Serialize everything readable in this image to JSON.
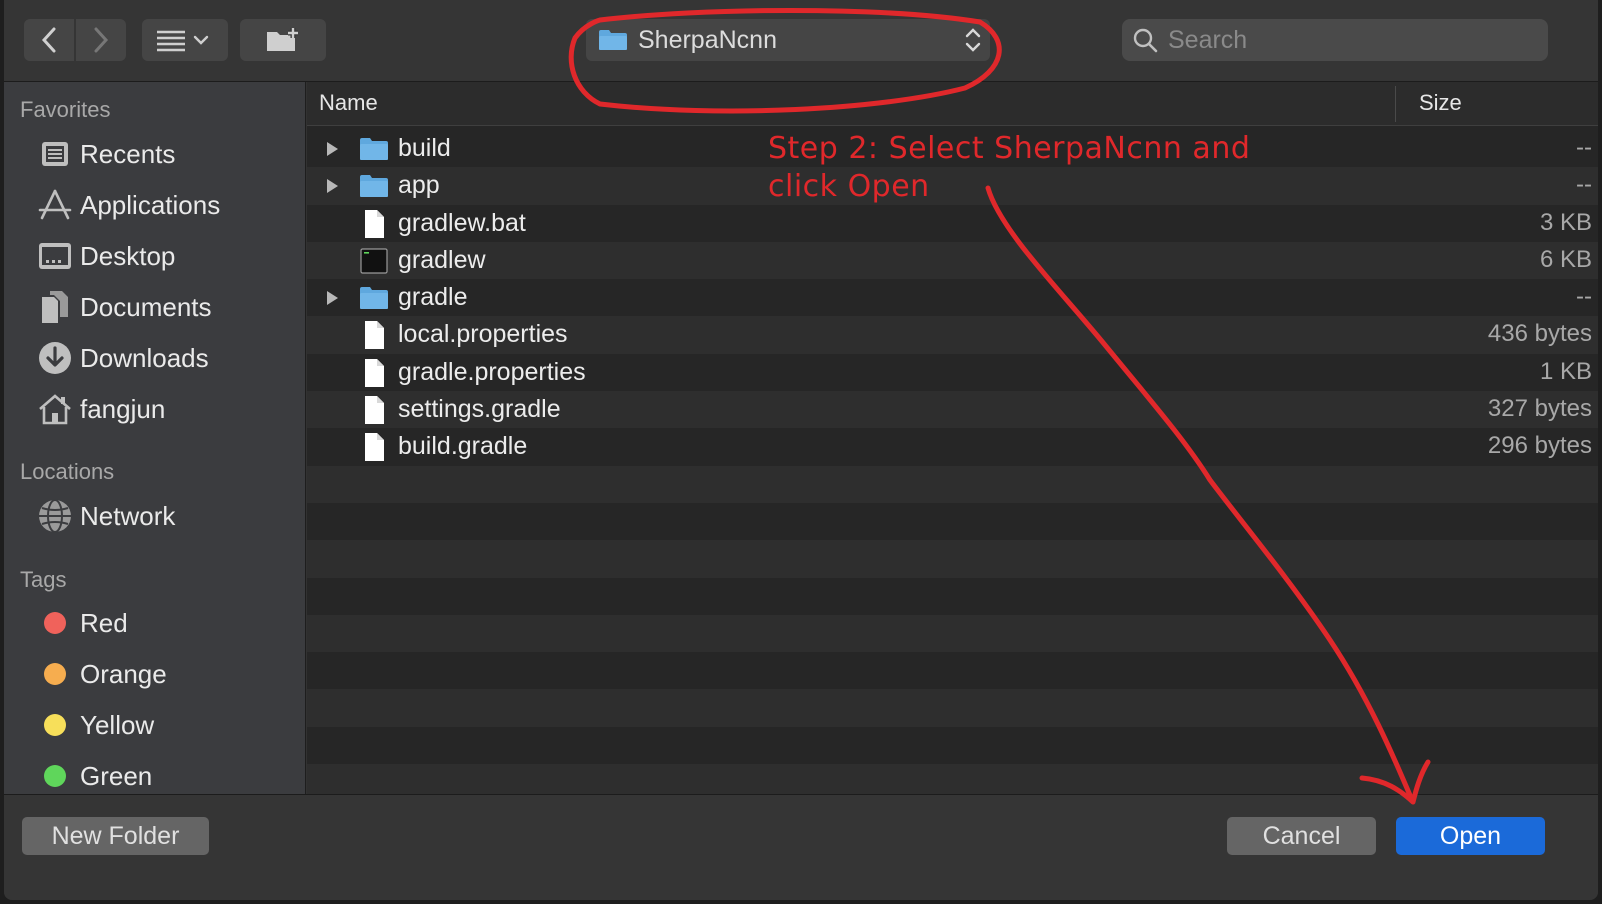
{
  "toolbar": {
    "current_folder": "SherpaNcnn",
    "search_placeholder": "Search"
  },
  "sidebar": {
    "favorites_heading": "Favorites",
    "favorites": [
      {
        "label": "Recents",
        "icon": "recents-icon"
      },
      {
        "label": "Applications",
        "icon": "applications-icon"
      },
      {
        "label": "Desktop",
        "icon": "desktop-icon"
      },
      {
        "label": "Documents",
        "icon": "documents-icon"
      },
      {
        "label": "Downloads",
        "icon": "downloads-icon"
      },
      {
        "label": "fangjun",
        "icon": "home-icon"
      }
    ],
    "locations_heading": "Locations",
    "locations": [
      {
        "label": "Network",
        "icon": "network-icon"
      }
    ],
    "tags_heading": "Tags",
    "tags": [
      {
        "label": "Red",
        "color": "#f0625b"
      },
      {
        "label": "Orange",
        "color": "#f6ad4f"
      },
      {
        "label": "Yellow",
        "color": "#f7df5a"
      },
      {
        "label": "Green",
        "color": "#5fd65b"
      }
    ]
  },
  "list": {
    "col_name": "Name",
    "col_size": "Size",
    "files": [
      {
        "name": "build",
        "size": "--",
        "kind": "folder"
      },
      {
        "name": "app",
        "size": "--",
        "kind": "folder"
      },
      {
        "name": "gradlew.bat",
        "size": "3 KB",
        "kind": "file"
      },
      {
        "name": "gradlew",
        "size": "6 KB",
        "kind": "exec"
      },
      {
        "name": "gradle",
        "size": "--",
        "kind": "folder"
      },
      {
        "name": "local.properties",
        "size": "436 bytes",
        "kind": "file"
      },
      {
        "name": "gradle.properties",
        "size": "1 KB",
        "kind": "file"
      },
      {
        "name": "settings.gradle",
        "size": "327 bytes",
        "kind": "file"
      },
      {
        "name": "build.gradle",
        "size": "296 bytes",
        "kind": "file"
      }
    ]
  },
  "bottom": {
    "new_folder": "New Folder",
    "cancel": "Cancel",
    "open": "Open"
  },
  "annotation": {
    "line1": "Step 2: Select SherpaNcnn and",
    "line2": "click Open",
    "color": "#e0282b"
  },
  "colors": {
    "accent": "#1b6ad9",
    "folder": "#5fa8de"
  }
}
